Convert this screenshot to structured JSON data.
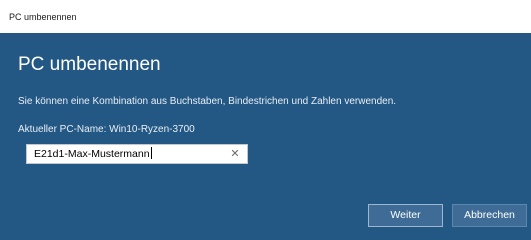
{
  "window": {
    "title": "PC umbenennen"
  },
  "dialog": {
    "heading": "PC umbenennen",
    "description": "Sie können eine Kombination aus Buchstaben, Bindestrichen und Zahlen verwenden.",
    "current_name_label": "Aktueller PC-Name: Win10-Ryzen-3700",
    "name_input": {
      "value": "E21d1-Max-Mustermann",
      "clear_glyph": "✕"
    },
    "buttons": {
      "next_label": "Weiter",
      "cancel_label": "Abbrechen"
    }
  },
  "colors": {
    "dialog_background": "#235885",
    "button_background": "#3e6c96"
  },
  "icons": {
    "clear": "close-icon"
  }
}
